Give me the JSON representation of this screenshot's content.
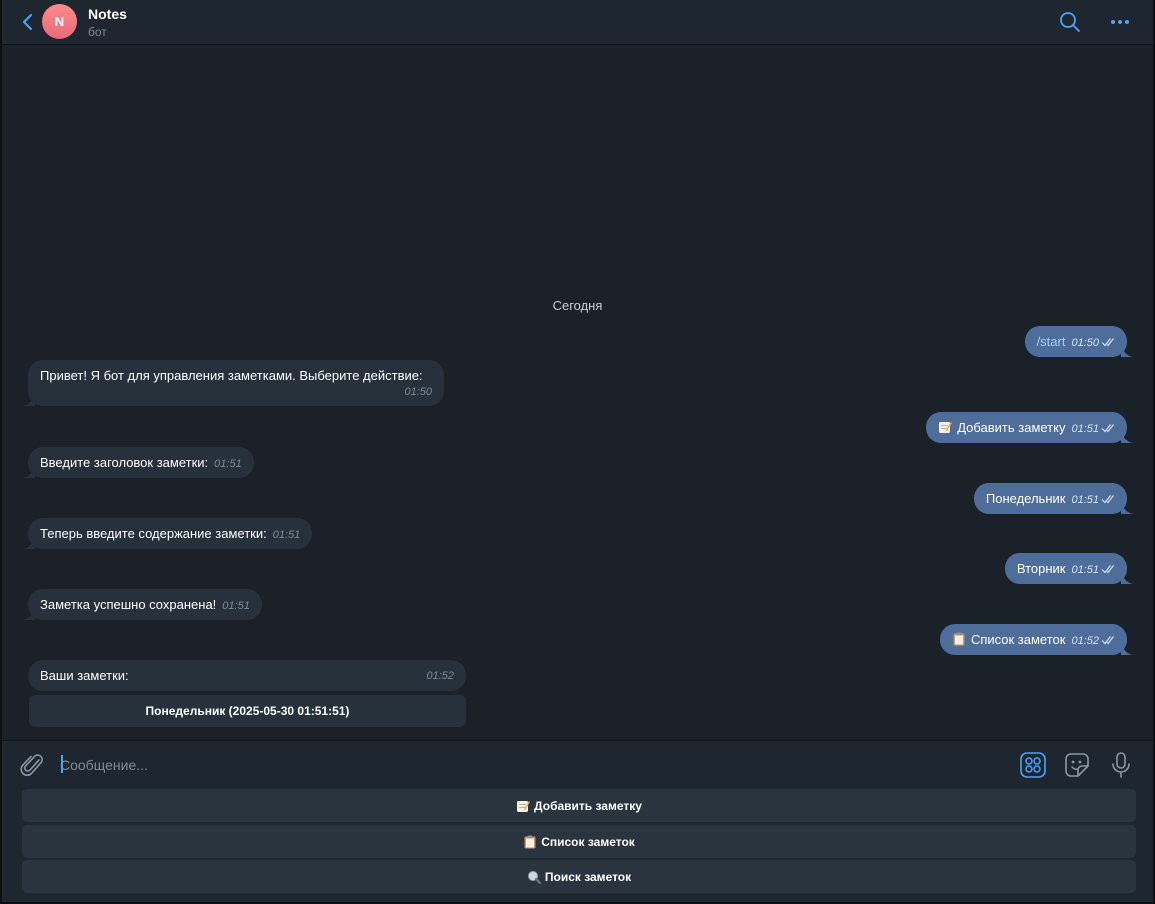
{
  "header": {
    "avatar_letter": "N",
    "title": "Notes",
    "subtitle": "бот"
  },
  "colors": {
    "accent": "#4aa3ff",
    "outgoing_bubble": "#4e6d9b",
    "incoming_bubble": "#27313c",
    "avatar": "#f07a84"
  },
  "date_separator": "Сегодня",
  "messages": [
    {
      "dir": "out",
      "text": "/start",
      "time": "01:50"
    },
    {
      "dir": "in",
      "text": "Привет! Я бот для управления заметками. Выберите действие:",
      "time": "01:50"
    },
    {
      "dir": "out",
      "text": "Добавить заметку",
      "time": "01:51",
      "icon": "memo-icon"
    },
    {
      "dir": "in",
      "text": "Введите заголовок заметки:",
      "time": "01:51"
    },
    {
      "dir": "out",
      "text": "Понедельник",
      "time": "01:51"
    },
    {
      "dir": "in",
      "text": "Теперь введите содержание заметки:",
      "time": "01:51"
    },
    {
      "dir": "out",
      "text": "Вторник",
      "time": "01:51"
    },
    {
      "dir": "in",
      "text": "Заметка успешно сохранена!",
      "time": "01:51"
    },
    {
      "dir": "out",
      "text": "Список заметок",
      "time": "01:52",
      "icon": "clipboard-icon"
    },
    {
      "dir": "in",
      "text": "Ваши заметки:",
      "time": "01:52"
    }
  ],
  "inline_keyboard": [
    {
      "label": "Понедельник (2025-05-30 01:51:51)"
    }
  ],
  "composer": {
    "placeholder": "Сообщение..."
  },
  "reply_keyboard": [
    {
      "label": "Добавить заметку",
      "icon": "memo-icon"
    },
    {
      "label": "Список заметок",
      "icon": "clipboard-icon"
    },
    {
      "label": "Поиск заметок",
      "icon": "magnifier-icon"
    }
  ]
}
